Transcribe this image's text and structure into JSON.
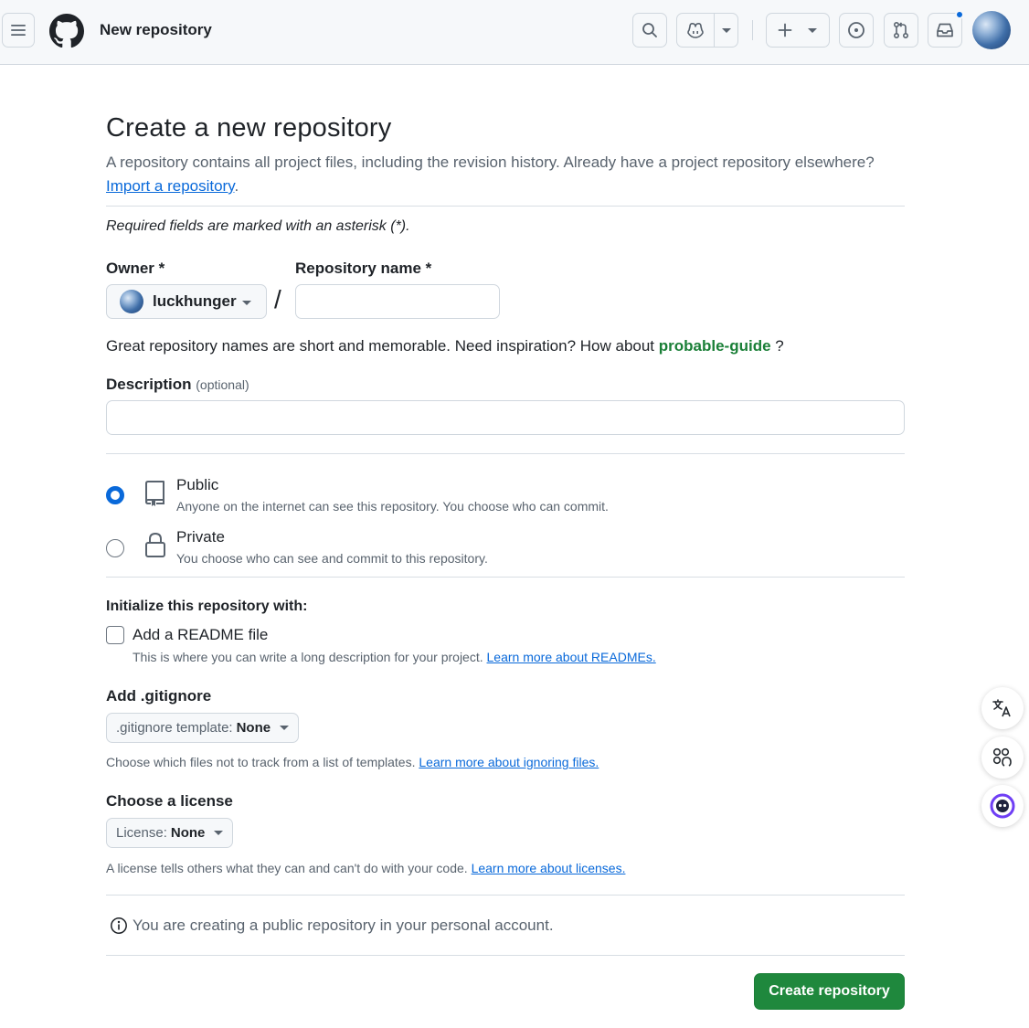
{
  "header": {
    "context_title": "New repository",
    "icons": [
      "hamburger-icon",
      "github-logo-icon",
      "search-icon",
      "copilot-icon",
      "plus-icon",
      "issue-icon",
      "pull-request-icon",
      "inbox-icon"
    ]
  },
  "page": {
    "title": "Create a new repository",
    "subtitle": "A repository contains all project files, including the revision history. Already have a project repository elsewhere?",
    "import_link": "Import a repository",
    "import_suffix": ".",
    "required_note": "Required fields are marked with an asterisk (*)."
  },
  "owner": {
    "label": "Owner *",
    "value": "luckhunger"
  },
  "repo_name": {
    "label": "Repository name *",
    "value": "",
    "placeholder": ""
  },
  "name_hint": {
    "text": "Great repository names are short and memorable. Need inspiration? How about",
    "suggestion": "probable-guide",
    "suffix": "?"
  },
  "description": {
    "label": "Description",
    "optional": "(optional)",
    "value": ""
  },
  "visibility": {
    "selected": "public",
    "options": [
      {
        "title": "Public",
        "desc": "Anyone on the internet can see this repository. You choose who can commit."
      },
      {
        "title": "Private",
        "desc": "You choose who can see and commit to this repository."
      }
    ]
  },
  "initialize": {
    "heading": "Initialize this repository with:",
    "readme_label": "Add a README file",
    "readme_checked": false,
    "readme_desc": "This is where you can write a long description for your project.",
    "readme_link": "Learn more about READMEs."
  },
  "gitignore": {
    "heading": "Add .gitignore",
    "select_prefix": ".gitignore template:",
    "select_value": "None",
    "desc": "Choose which files not to track from a list of templates.",
    "link": "Learn more about ignoring files."
  },
  "license": {
    "heading": "Choose a license",
    "select_prefix": "License:",
    "select_value": "None",
    "desc": "A license tells others what they can and can't do with your code.",
    "link": "Learn more about licenses."
  },
  "info": {
    "text": "You are creating a public repository in your personal account."
  },
  "submit": {
    "label": "Create repository"
  },
  "colors": {
    "accent": "#0969da",
    "primary_button": "#1f883d",
    "suggestion": "#1a7f37"
  }
}
